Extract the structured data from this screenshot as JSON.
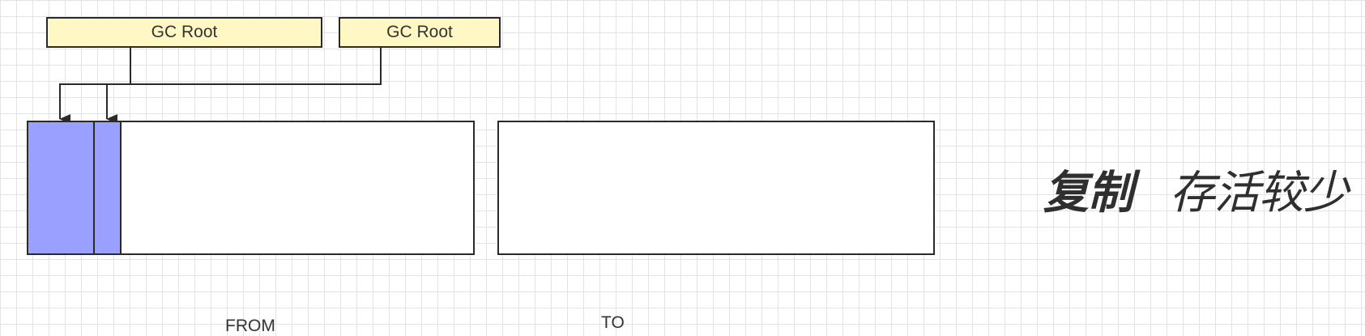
{
  "gc_roots": [
    {
      "label": "GC Root"
    },
    {
      "label": "GC Root"
    }
  ],
  "regions": {
    "from_label": "FROM",
    "to_label": "TO"
  },
  "annotation": {
    "title": "复制",
    "subtitle": "存活较少"
  },
  "colors": {
    "root_fill": "#fff8c4",
    "live_object_fill": "#99a0ff",
    "grid_line": "#e3e3e3",
    "stroke": "#2a2a2a"
  }
}
